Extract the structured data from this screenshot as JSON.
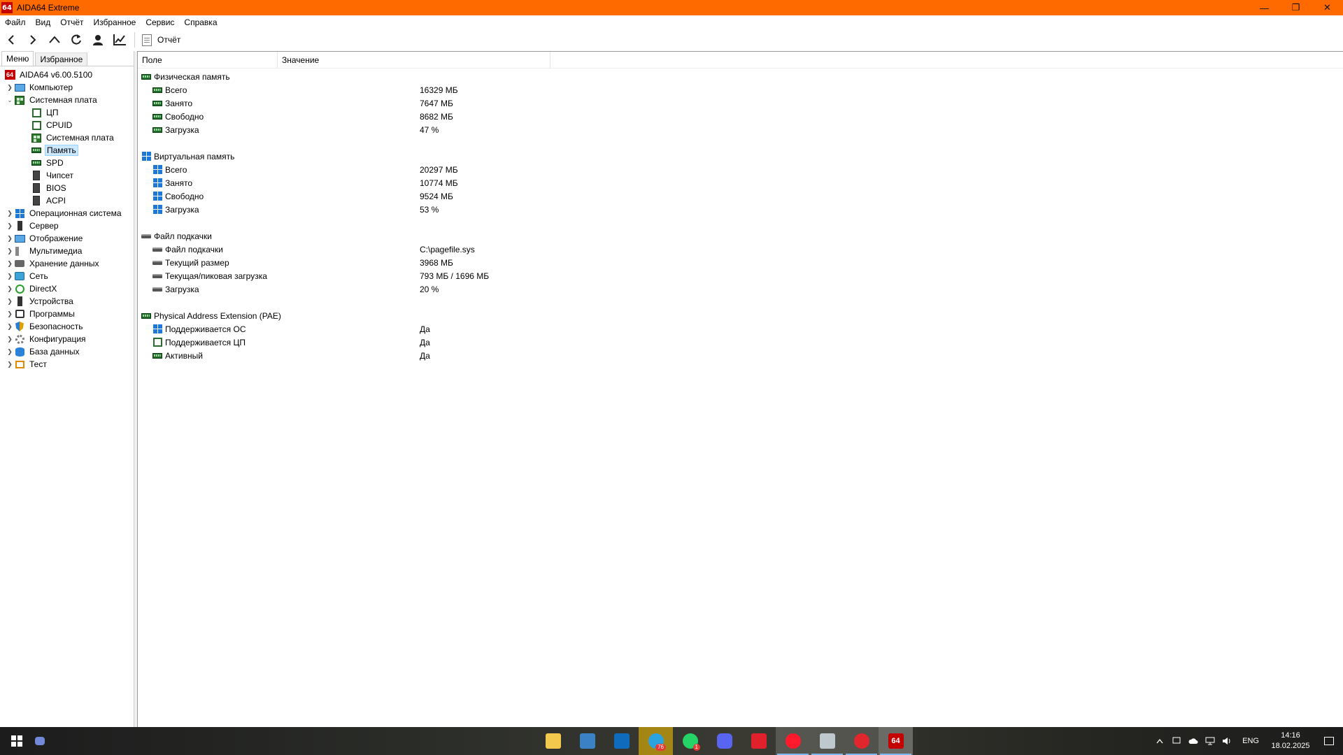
{
  "window": {
    "title": "AIDA64 Extreme",
    "app_icon_text": "64",
    "controls": {
      "minimize": "—",
      "restore": "❐",
      "close": "✕"
    }
  },
  "menu": [
    "Файл",
    "Вид",
    "Отчёт",
    "Избранное",
    "Сервис",
    "Справка"
  ],
  "toolbar": {
    "report_label": "Отчёт",
    "buttons": [
      "back-icon",
      "forward-icon",
      "up-icon",
      "refresh-icon",
      "user-icon",
      "chart-icon"
    ]
  },
  "left_panel": {
    "tabs": [
      "Меню",
      "Избранное"
    ],
    "tree": [
      {
        "label": "AIDA64 v6.00.5100",
        "icon": "aida-icon"
      },
      {
        "label": "Компьютер",
        "icon": "computer-icon"
      },
      {
        "label": "Системная плата",
        "icon": "motherboard-icon"
      },
      {
        "label": "ЦП",
        "icon": "cpu-icon"
      },
      {
        "label": "CPUID",
        "icon": "cpuid-icon"
      },
      {
        "label": "Системная плата",
        "icon": "motherboard-icon"
      },
      {
        "label": "Память",
        "icon": "ram-icon"
      },
      {
        "label": "SPD",
        "icon": "ram-icon"
      },
      {
        "label": "Чипсет",
        "icon": "chip-icon"
      },
      {
        "label": "BIOS",
        "icon": "chip-icon"
      },
      {
        "label": "ACPI",
        "icon": "chip-icon"
      },
      {
        "label": "Операционная система",
        "icon": "windows-icon"
      },
      {
        "label": "Сервер",
        "icon": "server-icon"
      },
      {
        "label": "Отображение",
        "icon": "monitor-icon"
      },
      {
        "label": "Мультимедиа",
        "icon": "speaker-icon"
      },
      {
        "label": "Хранение данных",
        "icon": "hdd-icon"
      },
      {
        "label": "Сеть",
        "icon": "network-icon"
      },
      {
        "label": "DirectX",
        "icon": "xbox-icon"
      },
      {
        "label": "Устройства",
        "icon": "device-icon"
      },
      {
        "label": "Программы",
        "icon": "programs-icon"
      },
      {
        "label": "Безопасность",
        "icon": "shield-icon"
      },
      {
        "label": "Конфигурация",
        "icon": "gear-icon"
      },
      {
        "label": "База данных",
        "icon": "database-icon"
      },
      {
        "label": "Тест",
        "icon": "test-icon"
      }
    ]
  },
  "table": {
    "headers": {
      "field": "Поле",
      "value": "Значение"
    },
    "groups": [
      {
        "title": "Физическая память",
        "icon": "ram-icon",
        "rows": [
          {
            "field": "Всего",
            "value": "16329 МБ"
          },
          {
            "field": "Занято",
            "value": "7647 МБ"
          },
          {
            "field": "Свободно",
            "value": "8682 МБ"
          },
          {
            "field": "Загрузка",
            "value": "47 %"
          }
        ]
      },
      {
        "title": "Виртуальная память",
        "icon": "windows-icon",
        "rows": [
          {
            "field": "Всего",
            "value": "20297 МБ"
          },
          {
            "field": "Занято",
            "value": "10774 МБ"
          },
          {
            "field": "Свободно",
            "value": "9524 МБ"
          },
          {
            "field": "Загрузка",
            "value": "53 %"
          }
        ]
      },
      {
        "title": "Файл подкачки",
        "icon": "disk-icon",
        "rows": [
          {
            "field": "Файл подкачки",
            "value": "C:\\pagefile.sys"
          },
          {
            "field": "Текущий размер",
            "value": "3968 МБ"
          },
          {
            "field": "Текущая/пиковая загрузка",
            "value": "793 МБ / 1696 МБ"
          },
          {
            "field": "Загрузка",
            "value": "20 %"
          }
        ]
      },
      {
        "title": "Physical Address Extension (PAE)",
        "icon": "ram-icon",
        "rows": [
          {
            "field": "Поддерживается ОС",
            "value": "Да"
          },
          {
            "field": "Поддерживается ЦП",
            "value": "Да"
          },
          {
            "field": "Активный",
            "value": "Да"
          }
        ]
      }
    ]
  },
  "taskbar": {
    "apps": [
      {
        "name": "file-explorer-icon",
        "color": "#f2c94c"
      },
      {
        "name": "store-icon",
        "color": "#3b82c4"
      },
      {
        "name": "outlook-icon",
        "color": "#0f6cbd"
      },
      {
        "name": "telegram-icon",
        "color": "#2aa3df",
        "badge": "76"
      },
      {
        "name": "whatsapp-icon",
        "color": "#25d366",
        "badge": "1"
      },
      {
        "name": "discord-icon",
        "color": "#5865f2"
      },
      {
        "name": "lm-icon",
        "color": "#e0202a"
      },
      {
        "name": "opera-icon",
        "color": "#ff1b2d"
      },
      {
        "name": "app-window-icon",
        "color": "#bfc7cf"
      },
      {
        "name": "red-app-icon",
        "color": "#e1262d"
      },
      {
        "name": "aida64-icon",
        "color": "#c40000",
        "text": "64"
      }
    ],
    "tray": {
      "language": "ENG",
      "time": "14:16",
      "date": "18.02.2025"
    }
  },
  "colors": {
    "titlebar": "#ff6a00",
    "selection": "#cce8ff",
    "accent": "#1e78d7"
  }
}
